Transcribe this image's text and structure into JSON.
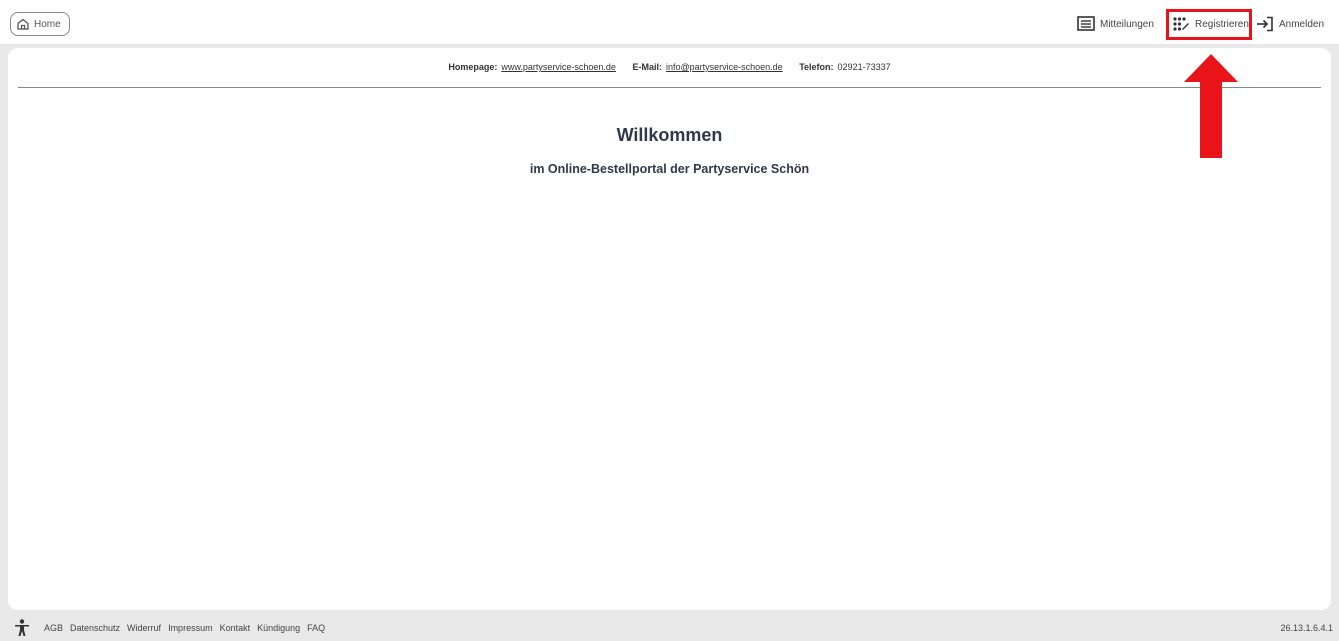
{
  "topbar": {
    "home_label": "Home",
    "nav": {
      "messages_label": "Mitteilungen",
      "register_label": "Registrieren",
      "login_label": "Anmelden"
    },
    "highlight_color": "#e8141a"
  },
  "contact": {
    "homepage_label": "Homepage:",
    "homepage_value": "www.partyservice-schoen.de",
    "email_label": "E-Mail:",
    "email_value": "info@partyservice-schoen.de",
    "phone_label": "Telefon:",
    "phone_value": "02921-73337"
  },
  "main": {
    "title": "Willkommen",
    "subtitle": "im Online-Bestellportal der Partyservice Schön"
  },
  "footer": {
    "links": [
      "AGB",
      "Datenschutz",
      "Widerruf",
      "Impressum",
      "Kontakt",
      "Kündigung",
      "FAQ"
    ],
    "version": "26.13.1.6.4.1"
  }
}
